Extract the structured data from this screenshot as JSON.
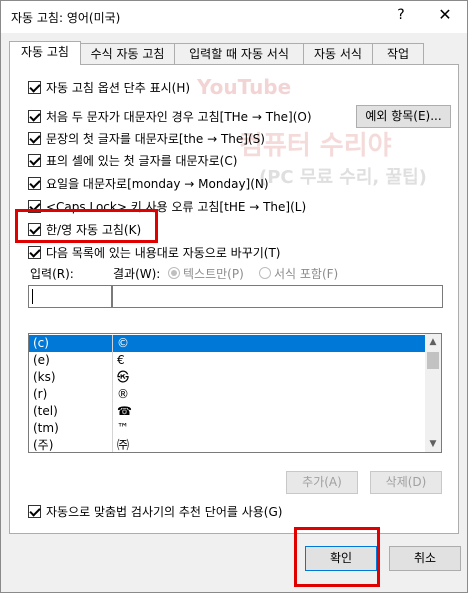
{
  "window": {
    "title": "자동 고침: 영어(미국)",
    "help_label": "?",
    "close_label": "✕"
  },
  "tabs": [
    {
      "label": "자동 고침",
      "active": true
    },
    {
      "label": "수식 자동 고침",
      "active": false
    },
    {
      "label": "입력할 때 자동 서식",
      "active": false
    },
    {
      "label": "자동 서식",
      "active": false
    },
    {
      "label": "작업",
      "active": false
    }
  ],
  "options": {
    "show_buttons": {
      "label": "자동 고침 옵션 단추 표시(H)",
      "checked": true
    },
    "two_initial_caps": {
      "label": "처음 두 문자가 대문자인 경우 고침[THe → The](O)",
      "checked": true
    },
    "sentence_caps": {
      "label": "문장의 첫 글자를 대문자로[the → The](S)",
      "checked": true
    },
    "table_cell_caps": {
      "label": "표의 셀에 있는 첫 글자를 대문자로(C)",
      "checked": true
    },
    "day_names": {
      "label": "요일을 대문자로[monday → Monday](N)",
      "checked": true
    },
    "caps_lock": {
      "label": "<Caps Lock> 키 사용 오류 고침[tHE → The](L)",
      "checked": true
    },
    "korean_english": {
      "label": "한/영 자동 고침(K)",
      "checked": true
    },
    "replace_as_you_type": {
      "label": "다음 목록에 있는 내용대로 자동으로 바꾸기(T)",
      "checked": true
    },
    "spell_suggest": {
      "label": "자동으로 맞춤법 검사기의 추천 단어를 사용(G)",
      "checked": true
    }
  },
  "exceptions_button": "예외 항목(E)...",
  "replace": {
    "input_label": "입력(R):",
    "result_label": "결과(W):",
    "plain_text": {
      "label": "텍스트만(P)",
      "selected": true
    },
    "formatted": {
      "label": "서식 포함(F)",
      "selected": false
    },
    "input_value": "",
    "result_value": ""
  },
  "entries": [
    {
      "from": "(c)",
      "to": "©",
      "selected": true
    },
    {
      "from": "(e)",
      "to": "€",
      "selected": false
    },
    {
      "from": "(ks)",
      "to": "㉿",
      "selected": false
    },
    {
      "from": "(r)",
      "to": "®",
      "selected": false
    },
    {
      "from": "(tel)",
      "to": "☎",
      "selected": false
    },
    {
      "from": "(tm)",
      "to": "™",
      "selected": false
    },
    {
      "from": "(주)",
      "to": "㈜",
      "selected": false
    }
  ],
  "buttons": {
    "add": "추가(A)",
    "delete": "삭제(D)",
    "ok": "확인",
    "cancel": "취소"
  },
  "watermark": {
    "line1": "YouTube",
    "line2": "컴퓨터 수리야",
    "line3": "(PC 무료 수리, 꿀팁)"
  },
  "colors": {
    "selection": "#0078d7",
    "highlight_box": "#e00000"
  }
}
